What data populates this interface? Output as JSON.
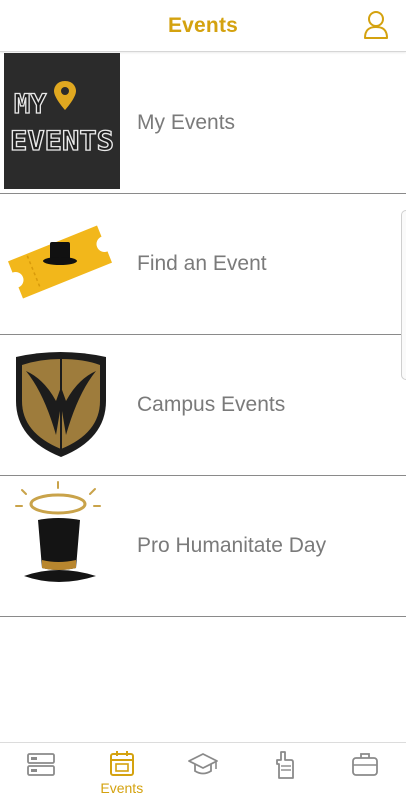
{
  "header": {
    "title": "Events",
    "profile_icon": "user-outline-icon"
  },
  "events": {
    "items": [
      {
        "label": "My Events",
        "image": "my-events-logo"
      },
      {
        "label": "Find an Event",
        "image": "ticket-tophat"
      },
      {
        "label": "Campus Events",
        "image": "shield-crest"
      },
      {
        "label": "Pro Humanitate Day",
        "image": "tophat-halo"
      }
    ]
  },
  "logo_text": {
    "line1": "MY",
    "line2": "EVENTS"
  },
  "tabbar": {
    "tabs": [
      {
        "label": "",
        "icon": "list-cards-icon",
        "active": false
      },
      {
        "label": "Events",
        "icon": "calendar-icon",
        "active": true
      },
      {
        "label": "",
        "icon": "graduation-cap-icon",
        "active": false
      },
      {
        "label": "",
        "icon": "foam-finger-icon",
        "active": false
      },
      {
        "label": "",
        "icon": "briefcase-icon",
        "active": false
      }
    ]
  },
  "colors": {
    "accent": "#d4a20f",
    "text": "#7a7a7a",
    "dark": "#2b2b2b",
    "gold": "#9e7c3c"
  }
}
